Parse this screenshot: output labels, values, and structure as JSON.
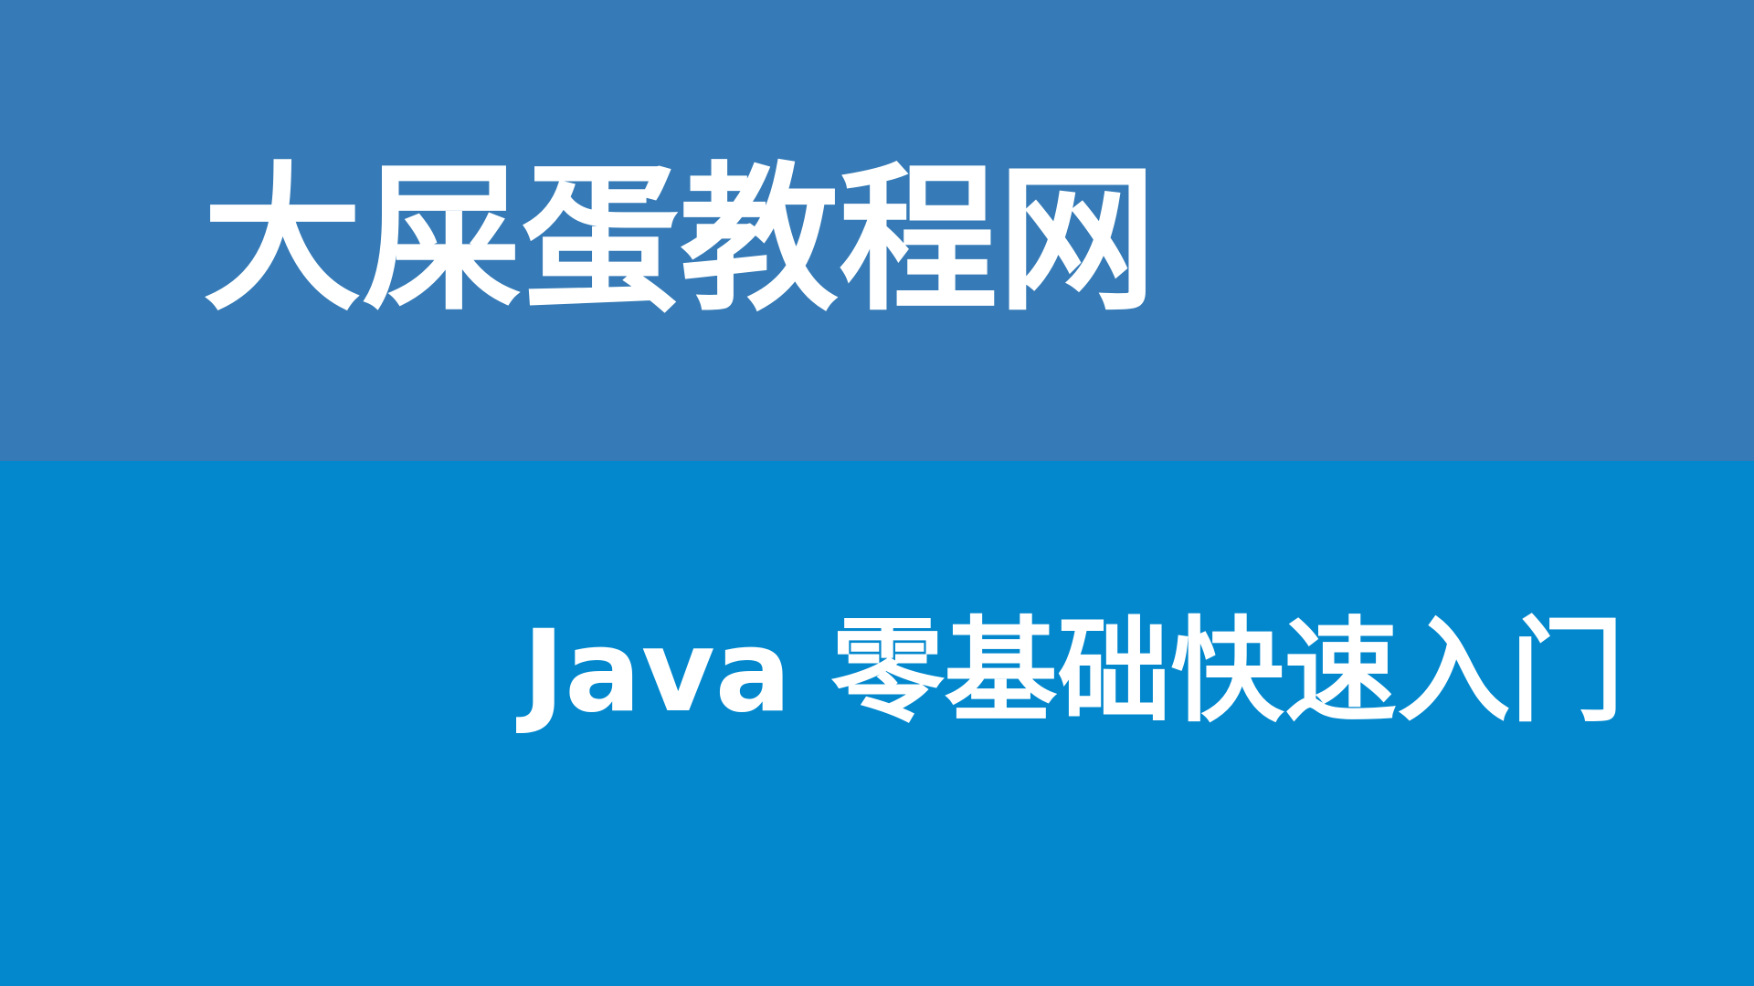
{
  "banner": {
    "title": "大屎蛋教程网",
    "subtitle": "Java 零基础快速入门",
    "colors": {
      "top": "#367bb7",
      "bottom": "#0388ce",
      "text": "#ffffff"
    }
  }
}
